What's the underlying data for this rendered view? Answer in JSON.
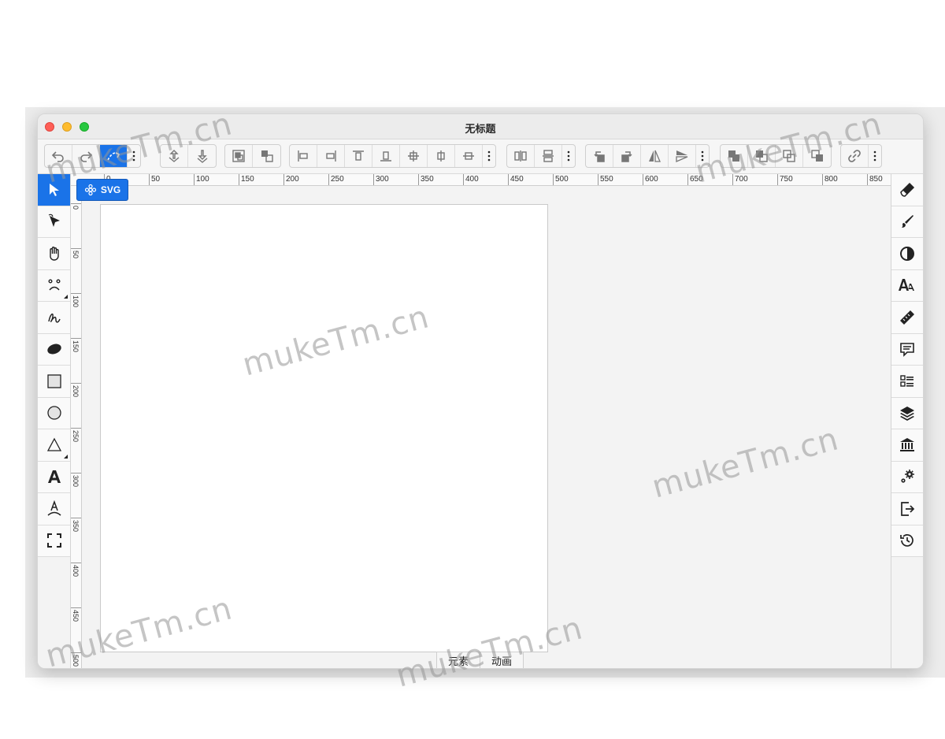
{
  "window": {
    "title": "无标题"
  },
  "toolbar": {
    "groups": [
      [
        "undo-icon",
        "redo-icon",
        "link-path-icon"
      ],
      [
        "move-up-icon",
        "move-down-icon"
      ],
      [
        "group-icon",
        "ungroup-icon"
      ],
      [
        "align-left-icon",
        "align-right-icon",
        "align-top-icon",
        "align-bottom-icon",
        "align-center-icon",
        "align-middle-icon",
        "distribute-icon"
      ],
      [
        "distribute-h-icon",
        "distribute-v-icon"
      ],
      [
        "rotate-left-icon",
        "rotate-right-icon",
        "flip-h-icon",
        "flip-v-icon"
      ],
      [
        "front-icon",
        "forward-icon",
        "backward-icon",
        "back-icon"
      ],
      [
        "link-icon"
      ]
    ]
  },
  "left_tools": [
    "select-icon",
    "node-edit-icon",
    "hand-icon",
    "face-icon",
    "freehand-icon",
    "ellipse-fill-icon",
    "rect-icon",
    "circle-icon",
    "triangle-icon",
    "text-icon",
    "text-path-icon",
    "fullscreen-icon"
  ],
  "right_tools": [
    "brush-fill-icon",
    "brush-icon",
    "contrast-icon",
    "font-size-icon",
    "ruler-icon",
    "comment-icon",
    "list-icon",
    "layers-icon",
    "library-icon",
    "settings-icon",
    "export-icon",
    "history-icon"
  ],
  "svg_button": {
    "label": "SVG"
  },
  "ruler": {
    "h_labels": [
      "0",
      "50",
      "100",
      "150",
      "200",
      "250",
      "300",
      "350",
      "400",
      "450",
      "500",
      "550",
      "600",
      "650",
      "700",
      "750",
      "800",
      "850"
    ],
    "v_labels": [
      "0",
      "50",
      "100",
      "150",
      "200",
      "250",
      "300",
      "350",
      "400",
      "450",
      "500"
    ]
  },
  "bottom_tabs": [
    "元素",
    "动画"
  ],
  "watermarks": [
    "mukeTm.cn",
    "mukeTm.cn",
    "mukeTm.cn",
    "mukeTm.cn",
    "mukeTm.cn",
    "mukeTm.cn",
    "mukeTm.cn"
  ]
}
